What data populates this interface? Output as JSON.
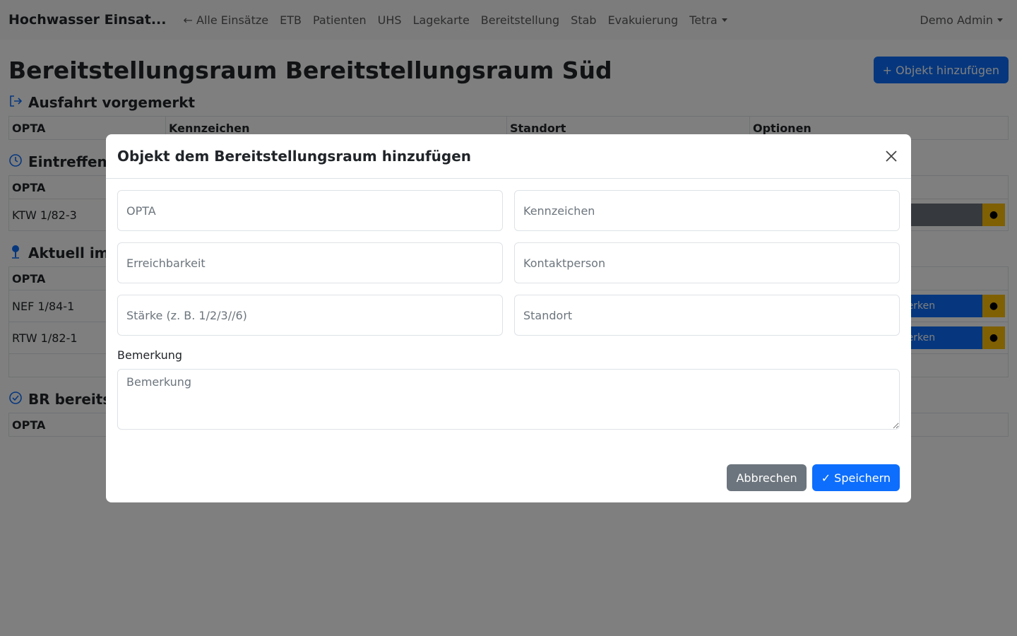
{
  "navbar": {
    "brand": "Hochwasser Einsat...",
    "links": [
      {
        "label": "← Alle Einsätze"
      },
      {
        "label": "ETB"
      },
      {
        "label": "Patienten"
      },
      {
        "label": "UHS"
      },
      {
        "label": "Lagekarte"
      },
      {
        "label": "Bereitstellung"
      },
      {
        "label": "Stab"
      },
      {
        "label": "Evakuierung"
      },
      {
        "label": "Tetra"
      }
    ],
    "user": "Demo Admin"
  },
  "page": {
    "title": "Bereitstellungsraum Bereitstellungsraum Süd",
    "add_button": "+ Objekt hinzufügen"
  },
  "sections": [
    {
      "title": "Ausfahrt vorgemerkt",
      "icon": "exit-icon",
      "headers": [
        "OPTA",
        "Kennzeichen",
        "Standort",
        "Optionen"
      ],
      "rows": []
    },
    {
      "title": "Eintreffen e",
      "icon": "clock-icon",
      "headers": [
        "OPTA"
      ],
      "rows": [
        {
          "opta": "KTW 1/82-3"
        }
      ]
    },
    {
      "title": "Aktuell im B",
      "icon": "pin-icon",
      "headers": [
        "OPTA"
      ],
      "rows": [
        {
          "opta": "NEF 1/84-1",
          "action": "merken"
        },
        {
          "opta": "RTW 1/82-1",
          "action": "merken"
        }
      ]
    },
    {
      "title": "BR bereits v",
      "icon": "check-circle-icon",
      "headers": [
        "OPTA"
      ],
      "rows": []
    }
  ],
  "modal": {
    "title": "Objekt dem Bereitstellungsraum hinzufügen",
    "fields": {
      "opta": "OPTA",
      "kennzeichen": "Kennzeichen",
      "erreichbarkeit": "Erreichbarkeit",
      "kontaktperson": "Kontaktperson",
      "staerke": "Stärke (z. B. 1/2/3//6)",
      "standort": "Standort"
    },
    "remark_label": "Bemerkung",
    "remark_placeholder": "Bemerkung",
    "cancel_label": "Abbrechen",
    "save_label": "✓ Speichern"
  },
  "colors": {
    "primary": "#0d6efd",
    "secondary": "#6c757d",
    "warning": "#ffc107"
  }
}
